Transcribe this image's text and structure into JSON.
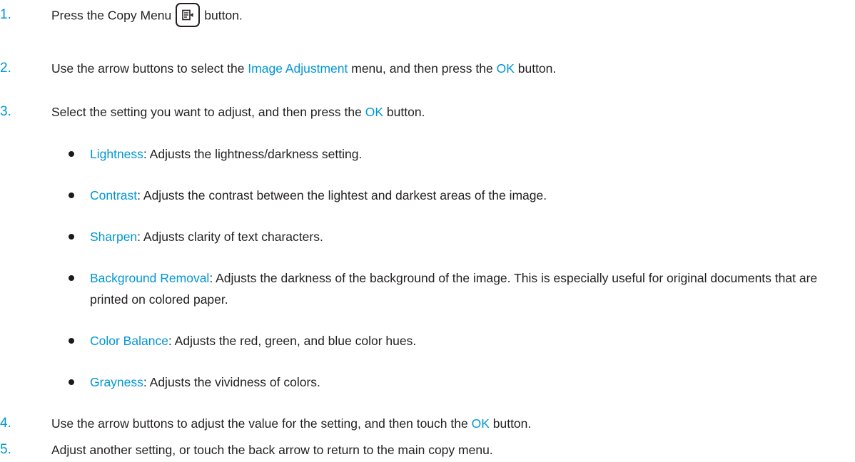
{
  "steps": [
    {
      "number": "1.",
      "before": "Press the Copy Menu",
      "icon": "copy-menu-icon",
      "after": "button."
    },
    {
      "number": "2.",
      "before": "Use the arrow buttons to select the ",
      "term1": "Image Adjustment",
      "middle": " menu, and then press the ",
      "term2": "OK",
      "after": " button."
    },
    {
      "number": "3.",
      "before": "Select the setting you want to adjust, and then press the ",
      "term": "OK",
      "after": " button."
    },
    {
      "number": "4.",
      "before": "Use the arrow buttons to adjust the value for the setting, and then touch the ",
      "term": "OK",
      "after": " button."
    },
    {
      "number": "5.",
      "text": "Adjust another setting, or touch the back arrow to return to the main copy menu."
    }
  ],
  "settings": [
    {
      "name": "Lightness",
      "desc": ": Adjusts the lightness/darkness setting."
    },
    {
      "name": "Contrast",
      "desc": ": Adjusts the contrast between the lightest and darkest areas of the image."
    },
    {
      "name": "Sharpen",
      "desc": ": Adjusts clarity of text characters."
    },
    {
      "name": "Background Removal",
      "desc": ": Adjusts the darkness of the background of the image. This is especially useful for original documents that are printed on colored paper."
    },
    {
      "name": "Color Balance",
      "desc": ": Adjusts the red, green, and blue color hues."
    },
    {
      "name": "Grayness",
      "desc": ": Adjusts the vividness of colors."
    }
  ],
  "colors": {
    "accent": "#0096d6",
    "text": "#231f20"
  }
}
